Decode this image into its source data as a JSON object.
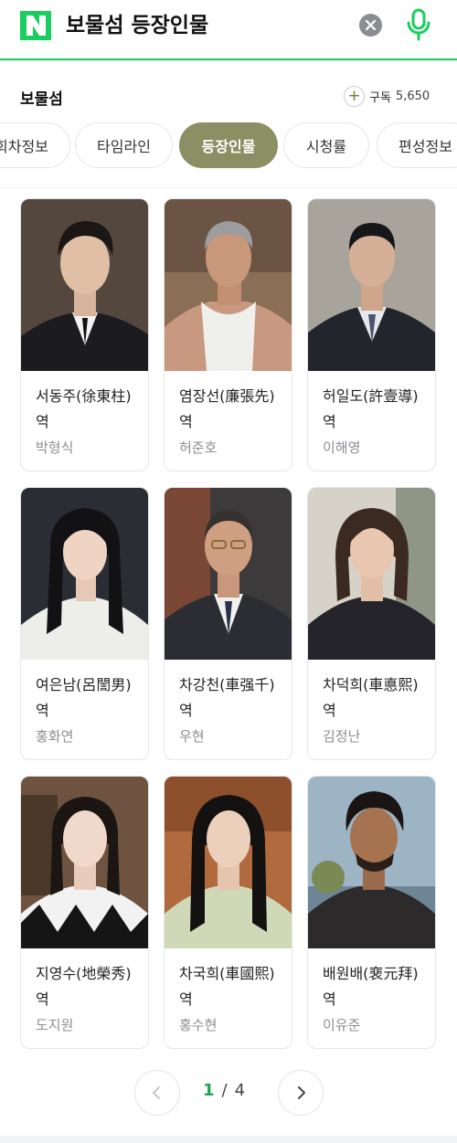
{
  "search": {
    "query": "보물섬 등장인물",
    "logo_letter": "N",
    "clear_icon": "close-icon",
    "mic_icon": "mic-icon",
    "accent_color": "#19ce60"
  },
  "program": {
    "title": "보물섬",
    "subscribe_label": "구독",
    "subscribe_count": "5,650"
  },
  "tabs": [
    {
      "label": "회차정보",
      "active": false
    },
    {
      "label": "타임라인",
      "active": false
    },
    {
      "label": "등장인물",
      "active": true
    },
    {
      "label": "시청률",
      "active": false
    },
    {
      "label": "편성정보",
      "active": false
    }
  ],
  "cast": [
    {
      "role": "서동주(徐東柱) 역",
      "actor": "박형식"
    },
    {
      "role": "염장선(廉張先) 역",
      "actor": "허준호"
    },
    {
      "role": "허일도(許壹導) 역",
      "actor": "이해영"
    },
    {
      "role": "여은남(呂誾男) 역",
      "actor": "홍화연"
    },
    {
      "role": "차강천(車强千) 역",
      "actor": "우현"
    },
    {
      "role": "차덕희(車悳熙) 역",
      "actor": "김정난"
    },
    {
      "role": "지영수(地榮秀) 역",
      "actor": "도지원"
    },
    {
      "role": "차국희(車國熙) 역",
      "actor": "홍수현"
    },
    {
      "role": "배원배(裵元拜) 역",
      "actor": "이유준"
    }
  ],
  "pagination": {
    "current": "1",
    "separator": "/",
    "total": "4",
    "prev_icon": "chevron-left-icon",
    "next_icon": "chevron-right-icon",
    "current_color": "#1aa553"
  }
}
